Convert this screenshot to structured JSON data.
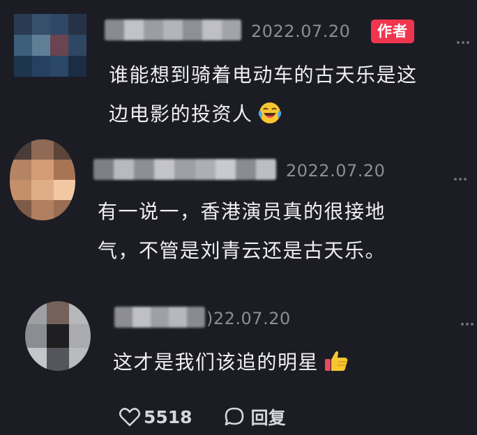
{
  "comments": [
    {
      "date": "2022.07.20",
      "badge": "作者",
      "text_line1": "谁能想到骑着电动车的古天乐是这",
      "text_line2": "边电影的投资人",
      "emoji": "laughing-tears-emoji"
    },
    {
      "date": "2022.07.20",
      "text_line1": "有一说一，香港演员真的很接地",
      "text_line2": "气，不管是刘青云还是古天乐。"
    },
    {
      "date": ")22.07.20",
      "text_line1": "这才是我们该追的明星",
      "emoji": "thumbs-up-emoji"
    }
  ],
  "actions": {
    "like_count": "5518",
    "reply_label": "回复"
  },
  "colors": {
    "background": "#1c1d24",
    "author_badge": "#f0364e",
    "date_text": "#8d8e95",
    "body_text": "#f0f0f2"
  },
  "icons": {
    "like": "heart-outline-icon",
    "reply": "speech-bubble-icon",
    "more": "more-dots-icon"
  }
}
